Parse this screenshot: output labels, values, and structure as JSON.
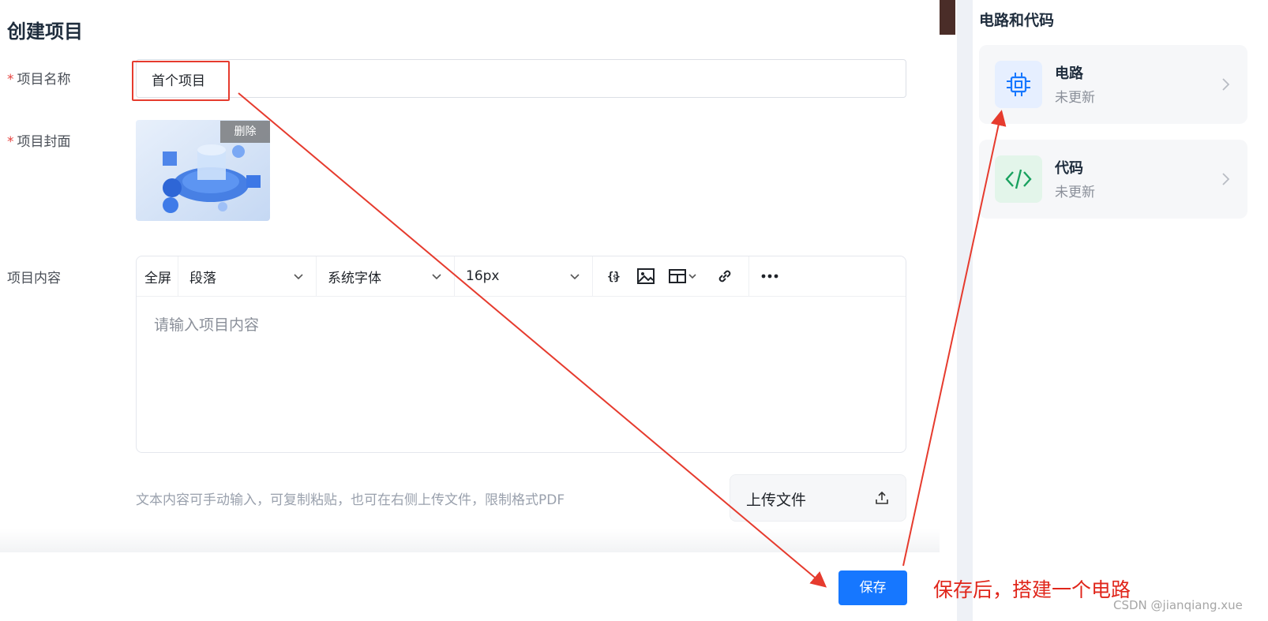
{
  "form": {
    "title": "创建项目",
    "name_label": "项目名称",
    "name_value": "首个项目",
    "cover_label": "项目封面",
    "delete_label": "删除",
    "content_label": "项目内容",
    "required_mark": "*"
  },
  "editor": {
    "fullscreen": "全屏",
    "paragraph": "段落",
    "font": "系统字体",
    "size": "16px",
    "placeholder": "请输入项目内容",
    "tools": [
      "code-icon",
      "image-icon",
      "table-icon",
      "link-icon",
      "more-icon"
    ]
  },
  "upload": {
    "hint": "文本内容可手动输入，可复制粘贴，也可在右侧上传文件，限制格式PDF",
    "button": "上传文件"
  },
  "save_label": "保存",
  "right_panel": {
    "title": "电路和代码",
    "cards": [
      {
        "title": "电路",
        "status": "未更新",
        "icon": "chip-icon",
        "icon_color": "#1677ff",
        "bg": "#e6efff"
      },
      {
        "title": "代码",
        "status": "未更新",
        "icon": "code-brackets-icon",
        "icon_color": "#19a15f",
        "bg": "#e3f5ea"
      }
    ]
  },
  "annotation": {
    "text": "保存后，搭建一个电路",
    "color": "#e63b2e"
  },
  "watermark": "CSDN @jianqiang.xue"
}
